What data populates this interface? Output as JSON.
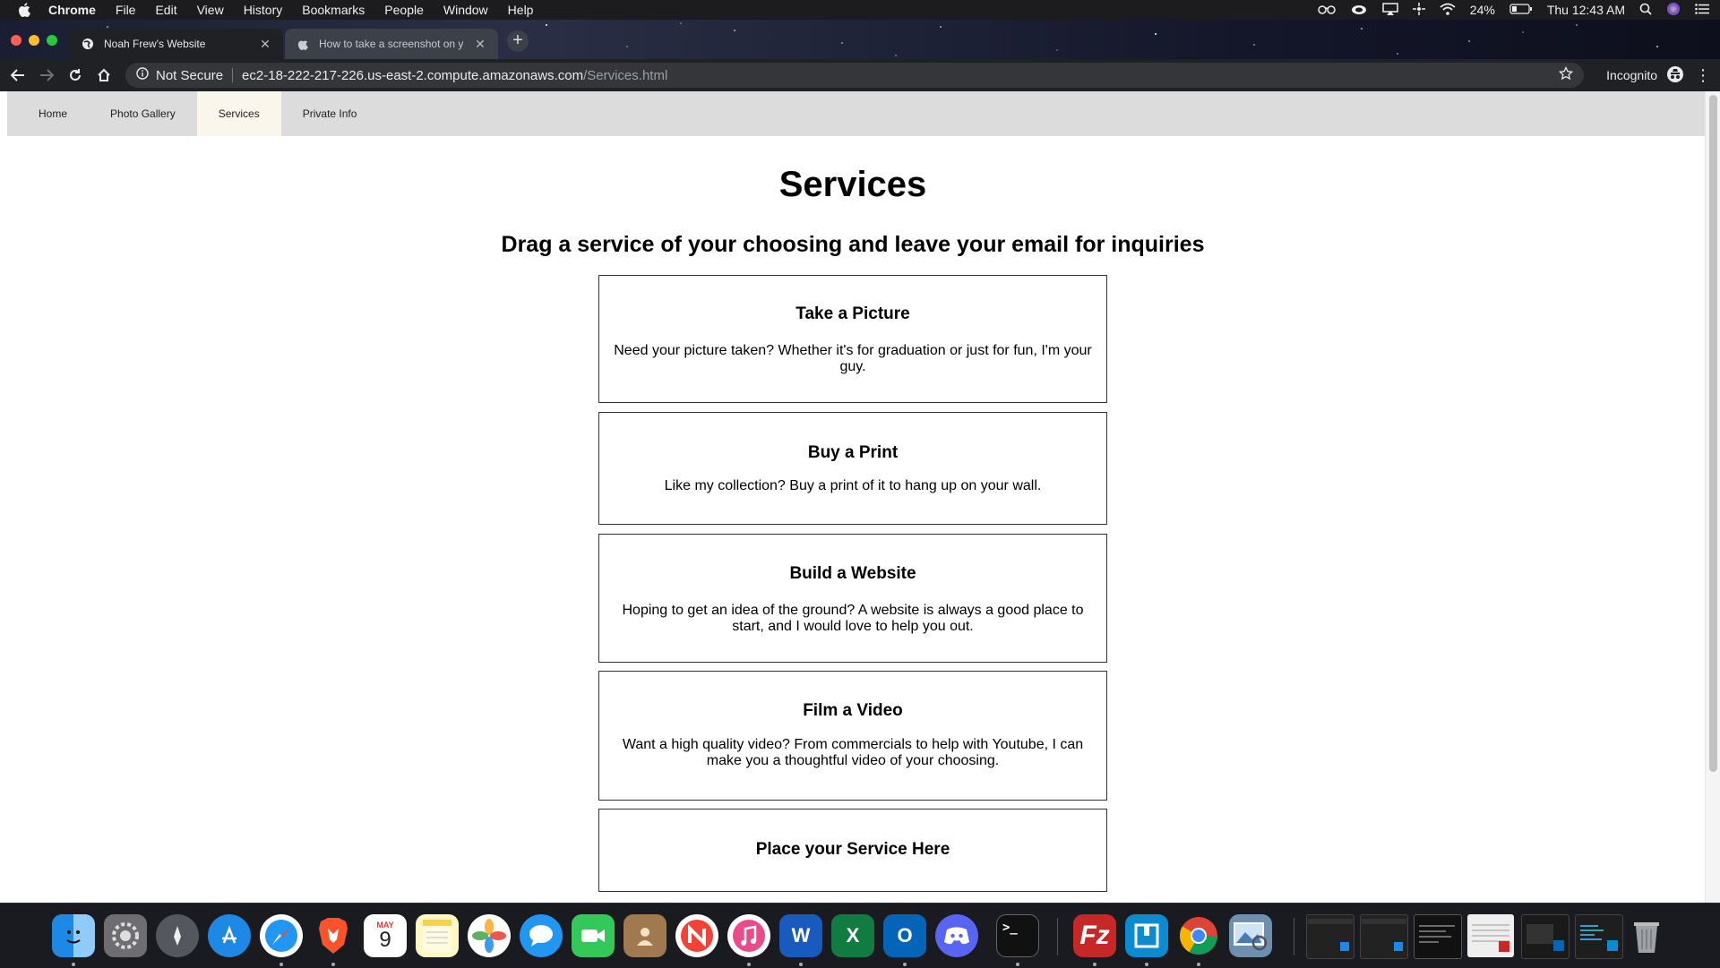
{
  "menubar": {
    "app_name": "Chrome",
    "items": [
      "File",
      "Edit",
      "View",
      "History",
      "Bookmarks",
      "People",
      "Window",
      "Help"
    ],
    "battery": "24%",
    "clock": "Thu 12:43 AM"
  },
  "tabs": [
    {
      "title": "Noah Frew's Website",
      "active": true
    },
    {
      "title": "How to take a screenshot on y",
      "active": false
    }
  ],
  "toolbar": {
    "security_label": "Not Secure",
    "url_host": "ec2-18-222-217-226.us-east-2.compute.amazonaws.com",
    "url_path": "/Services.html",
    "incognito_label": "Incognito"
  },
  "site_nav": {
    "items": [
      "Home",
      "Photo Gallery",
      "Services",
      "Private Info"
    ],
    "active": "Services"
  },
  "page": {
    "title": "Services",
    "subtitle": "Drag a service of your choosing and leave your email for inquiries"
  },
  "services": [
    {
      "title": "Take a Picture",
      "description": "Need your picture taken? Whether it's for graduation or just for fun, I'm your guy."
    },
    {
      "title": "Buy a Print",
      "description": "Like my collection? Buy a print of it to hang up on your wall."
    },
    {
      "title": "Build a Website",
      "description": "Hoping to get an idea of the ground? A website is always a good place to start, and I would love to help you out."
    },
    {
      "title": "Film a Video",
      "description": "Want a high quality video? From commercials to help with Youtube, I can make you a thoughtful video of your choosing."
    }
  ],
  "dropzone": {
    "title": "Place your Service Here"
  },
  "dock": {
    "apps": [
      "finder-icon",
      "system-preferences-icon",
      "launchpad-icon",
      "app-store-icon",
      "safari-icon",
      "brave-icon",
      "calendar-icon",
      "notes-icon",
      "photos-icon",
      "messages-icon",
      "facetime-icon",
      "contacts-icon",
      "news-icon",
      "itunes-icon",
      "word-icon",
      "excel-icon",
      "outlook-icon",
      "discord-icon",
      "terminal-icon",
      "filezilla-icon",
      "remote-desktop-icon",
      "chrome-icon",
      "preview-icon"
    ],
    "calendar_month": "MAY",
    "calendar_day": "9"
  },
  "colors": {
    "site_nav_bg": "#dcdcdc",
    "site_nav_active_bg": "#fbf6ec",
    "chrome_toolbar": "#202124"
  }
}
